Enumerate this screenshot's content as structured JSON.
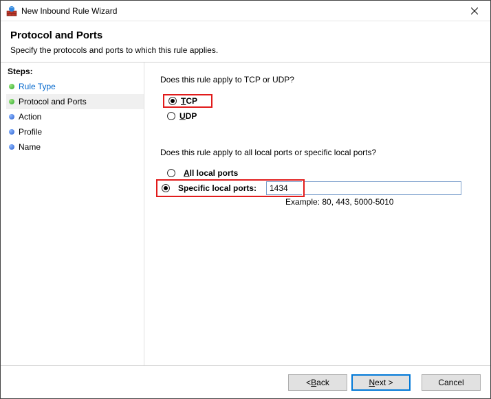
{
  "window": {
    "title": "New Inbound Rule Wizard"
  },
  "header": {
    "title": "Protocol and Ports",
    "subtitle": "Specify the protocols and ports to which this rule applies."
  },
  "sidebar": {
    "title": "Steps:",
    "items": [
      {
        "label": "Rule Type",
        "link": true,
        "bullet": "green"
      },
      {
        "label": "Protocol and Ports",
        "link": false,
        "bullet": "green",
        "active": true
      },
      {
        "label": "Action",
        "link": false,
        "bullet": "blue"
      },
      {
        "label": "Profile",
        "link": false,
        "bullet": "blue"
      },
      {
        "label": "Name",
        "link": false,
        "bullet": "blue"
      }
    ]
  },
  "main": {
    "question1": "Does this rule apply to TCP or UDP?",
    "protocol": {
      "tcp": {
        "label_prefix": "T",
        "label_rest": "CP",
        "selected": true
      },
      "udp": {
        "label_prefix": "U",
        "label_rest": "DP",
        "selected": false
      }
    },
    "question2": "Does this rule apply to all local ports or specific local ports?",
    "ports": {
      "all": {
        "label_prefix": "A",
        "label_rest": "ll local ports",
        "selected": false
      },
      "specific": {
        "label_rest": "Specific local ports:",
        "selected": true
      },
      "value": "1434",
      "example": "Example: 80, 443, 5000-5010"
    }
  },
  "footer": {
    "back": {
      "prefix": "< ",
      "ul": "B",
      "rest": "ack"
    },
    "next": {
      "ul": "N",
      "rest": "ext >"
    },
    "cancel": "Cancel"
  }
}
